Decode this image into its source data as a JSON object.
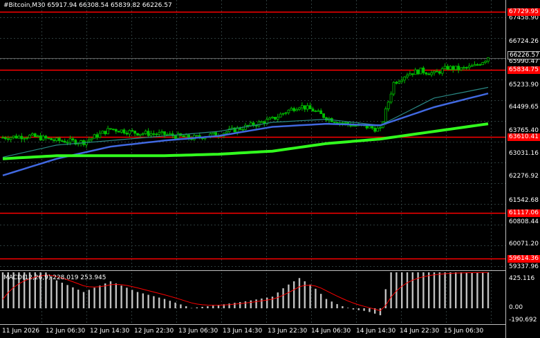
{
  "chart_title": "#Bitcoin,M30  65917.94 66308.54 65839.82 66226.57",
  "price_axis": [
    "67458.90",
    "66724.26",
    "65990.47",
    "65233.90",
    "64499.65",
    "63765.40",
    "63031.16",
    "62276.92",
    "61542.68",
    "60808.44",
    "60071.20",
    "59337.96"
  ],
  "price_levels": [
    {
      "label": "67729.95",
      "value": 67729.95
    },
    {
      "label": "65834.75",
      "value": 65834.75
    },
    {
      "label": "63610.41",
      "value": 63610.41
    },
    {
      "label": "61117.06",
      "value": 61117.06
    },
    {
      "label": "59614.36",
      "value": 59614.36
    }
  ],
  "current_price": {
    "label": "66226.57",
    "value": 66226.57
  },
  "macd": {
    "title": "MACD(12,26,9) 228.019 253.945",
    "axis": [
      "425.116",
      "0.00",
      "-190.692"
    ]
  },
  "time_axis": [
    "11 Jun 2026",
    "12 Jun 06:30",
    "12 Jun 14:30",
    "12 Jun 22:30",
    "13 Jun 06:30",
    "13 Jun 14:30",
    "13 Jun 22:30",
    "14 Jun 06:30",
    "14 Jun 14:30",
    "14 Jun 22:30",
    "15 Jun 06:30"
  ],
  "colors": {
    "background": "#000000",
    "grid": "#2e3d3d",
    "candles": "#00c000",
    "level_lines": "#ff0000",
    "ma_fast": "#2a8a86",
    "ma_mid": "#4169e1",
    "ma_slow": "#32ff1e",
    "macd_hist": "#c0c0c0",
    "macd_signal": "#ff0000"
  },
  "chart_data": {
    "type": "line",
    "title": "#Bitcoin,M30",
    "ohlc_last": {
      "open": 65917.94,
      "high": 66308.54,
      "low": 65839.82,
      "close": 66226.57
    },
    "series": [
      {
        "x": [
          0,
          10,
          20,
          30,
          40,
          50,
          60,
          70,
          80,
          90,
          100,
          105,
          110,
          115,
          120,
          125,
          130,
          135,
          140
        ],
        "values": [
          63600,
          63650,
          63500,
          63450,
          63880,
          63750,
          63700,
          63580,
          63720,
          63950,
          64200,
          64450,
          64650,
          64500,
          64250,
          64100,
          64000,
          63950,
          63850
        ]
      },
      {
        "x": [
          140,
          145,
          150,
          155,
          160,
          165,
          170,
          175,
          180
        ],
        "values": [
          63850,
          65400,
          65700,
          65800,
          65700,
          65900,
          65850,
          65950,
          66226.57
        ]
      },
      {
        "x": [
          0,
          20,
          40,
          60,
          80,
          100,
          120,
          140,
          160,
          180
        ],
        "values": [
          62950,
          63350,
          63500,
          63650,
          63800,
          64100,
          64200,
          64000,
          64900,
          65250
        ]
      },
      {
        "x": [
          0,
          20,
          40,
          60,
          80,
          100,
          120,
          140,
          160,
          180
        ],
        "values": [
          62350,
          62900,
          63300,
          63500,
          63650,
          63950,
          64050,
          64000,
          64600,
          65050
        ]
      },
      {
        "x": [
          0,
          20,
          40,
          60,
          80,
          100,
          120,
          140,
          160,
          180
        ],
        "values": [
          62900,
          63000,
          63000,
          63000,
          63050,
          63150,
          63400,
          63550,
          63800,
          64050
        ]
      }
    ],
    "ylim": [
      59337.96,
      67900
    ]
  }
}
